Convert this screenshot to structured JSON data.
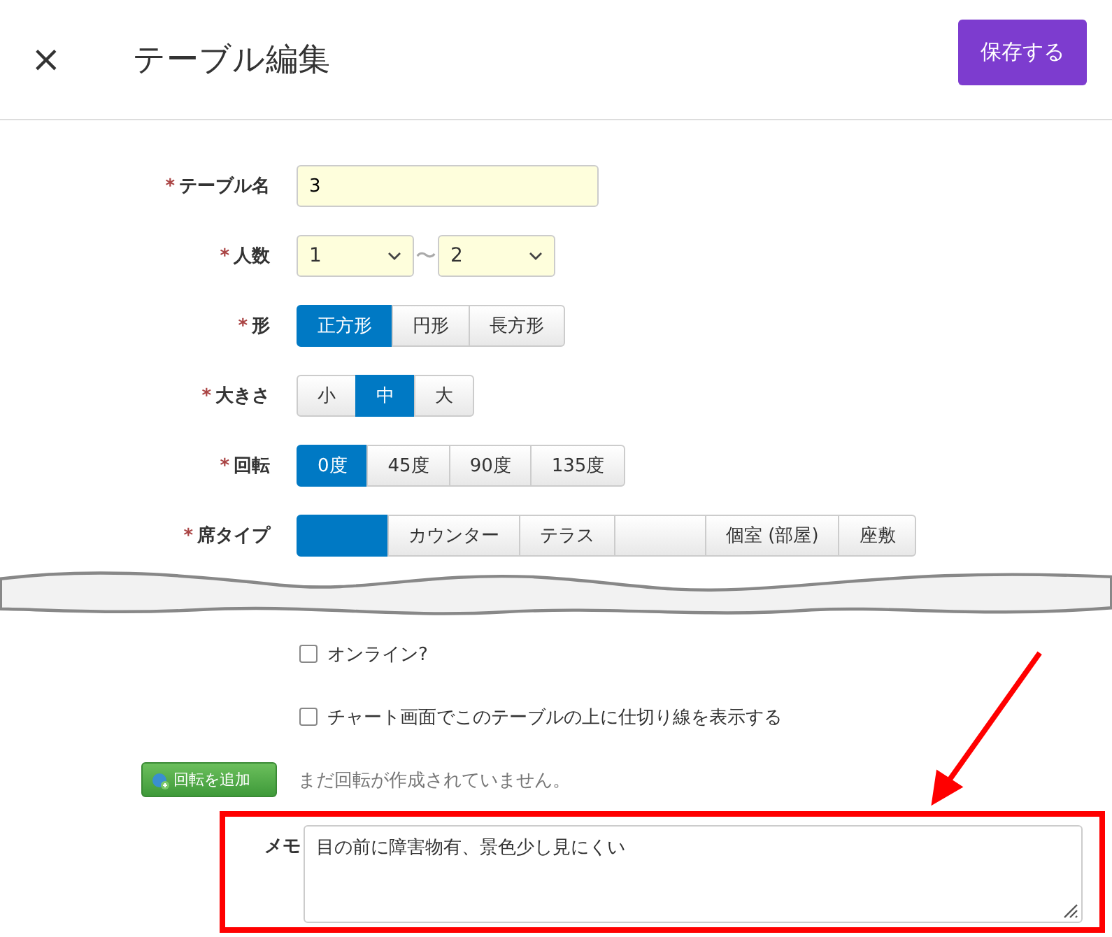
{
  "header": {
    "close": "×",
    "title": "テーブル編集",
    "save": "保存する"
  },
  "fields": [
    {
      "kind": "text",
      "mark": "*",
      "label": "テーブル名",
      "value": "3"
    },
    {
      "kind": "range",
      "mark": "*",
      "label": "人数",
      "from": "1",
      "separator": "〜",
      "to": "2"
    },
    {
      "kind": "segmented",
      "mark": "*",
      "label": "形",
      "options": [
        {
          "label": "正方形",
          "selected": true
        },
        {
          "label": "円形",
          "selected": false
        },
        {
          "label": "長方形",
          "selected": false
        }
      ]
    },
    {
      "kind": "segmented",
      "mark": "*",
      "label": "大きさ",
      "options": [
        {
          "label": "小",
          "selected": false
        },
        {
          "label": "中",
          "selected": true
        },
        {
          "label": "大",
          "selected": false
        }
      ]
    },
    {
      "kind": "segmented",
      "mark": "*",
      "label": "回転",
      "options": [
        {
          "label": "0度",
          "selected": true
        },
        {
          "label": "45度",
          "selected": false
        },
        {
          "label": "90度",
          "selected": false
        },
        {
          "label": "135度",
          "selected": false
        }
      ]
    },
    {
      "kind": "segmented",
      "mark": "*",
      "label": "席タイプ",
      "options": [
        {
          "selected": true
        },
        {
          "label": "カウンター",
          "selected": false
        },
        {
          "label": "テラス",
          "selected": false
        },
        {
          "selected": false
        },
        {
          "label": "個室 (部屋)",
          "selected": false
        },
        {
          "label": "座敷",
          "selected": false
        }
      ]
    }
  ],
  "checkboxes": [
    {
      "label": "オンライン?",
      "checked": false
    },
    {
      "label": "チャート画面でこのテーブルの上に仕切り線を表示する",
      "checked": false
    }
  ],
  "rotation": {
    "button": "回転を追加",
    "note": "まだ回転が作成されていません。"
  },
  "memo": {
    "label": "メモ",
    "value": "目の前に障害物有、景色少し見にくい"
  }
}
